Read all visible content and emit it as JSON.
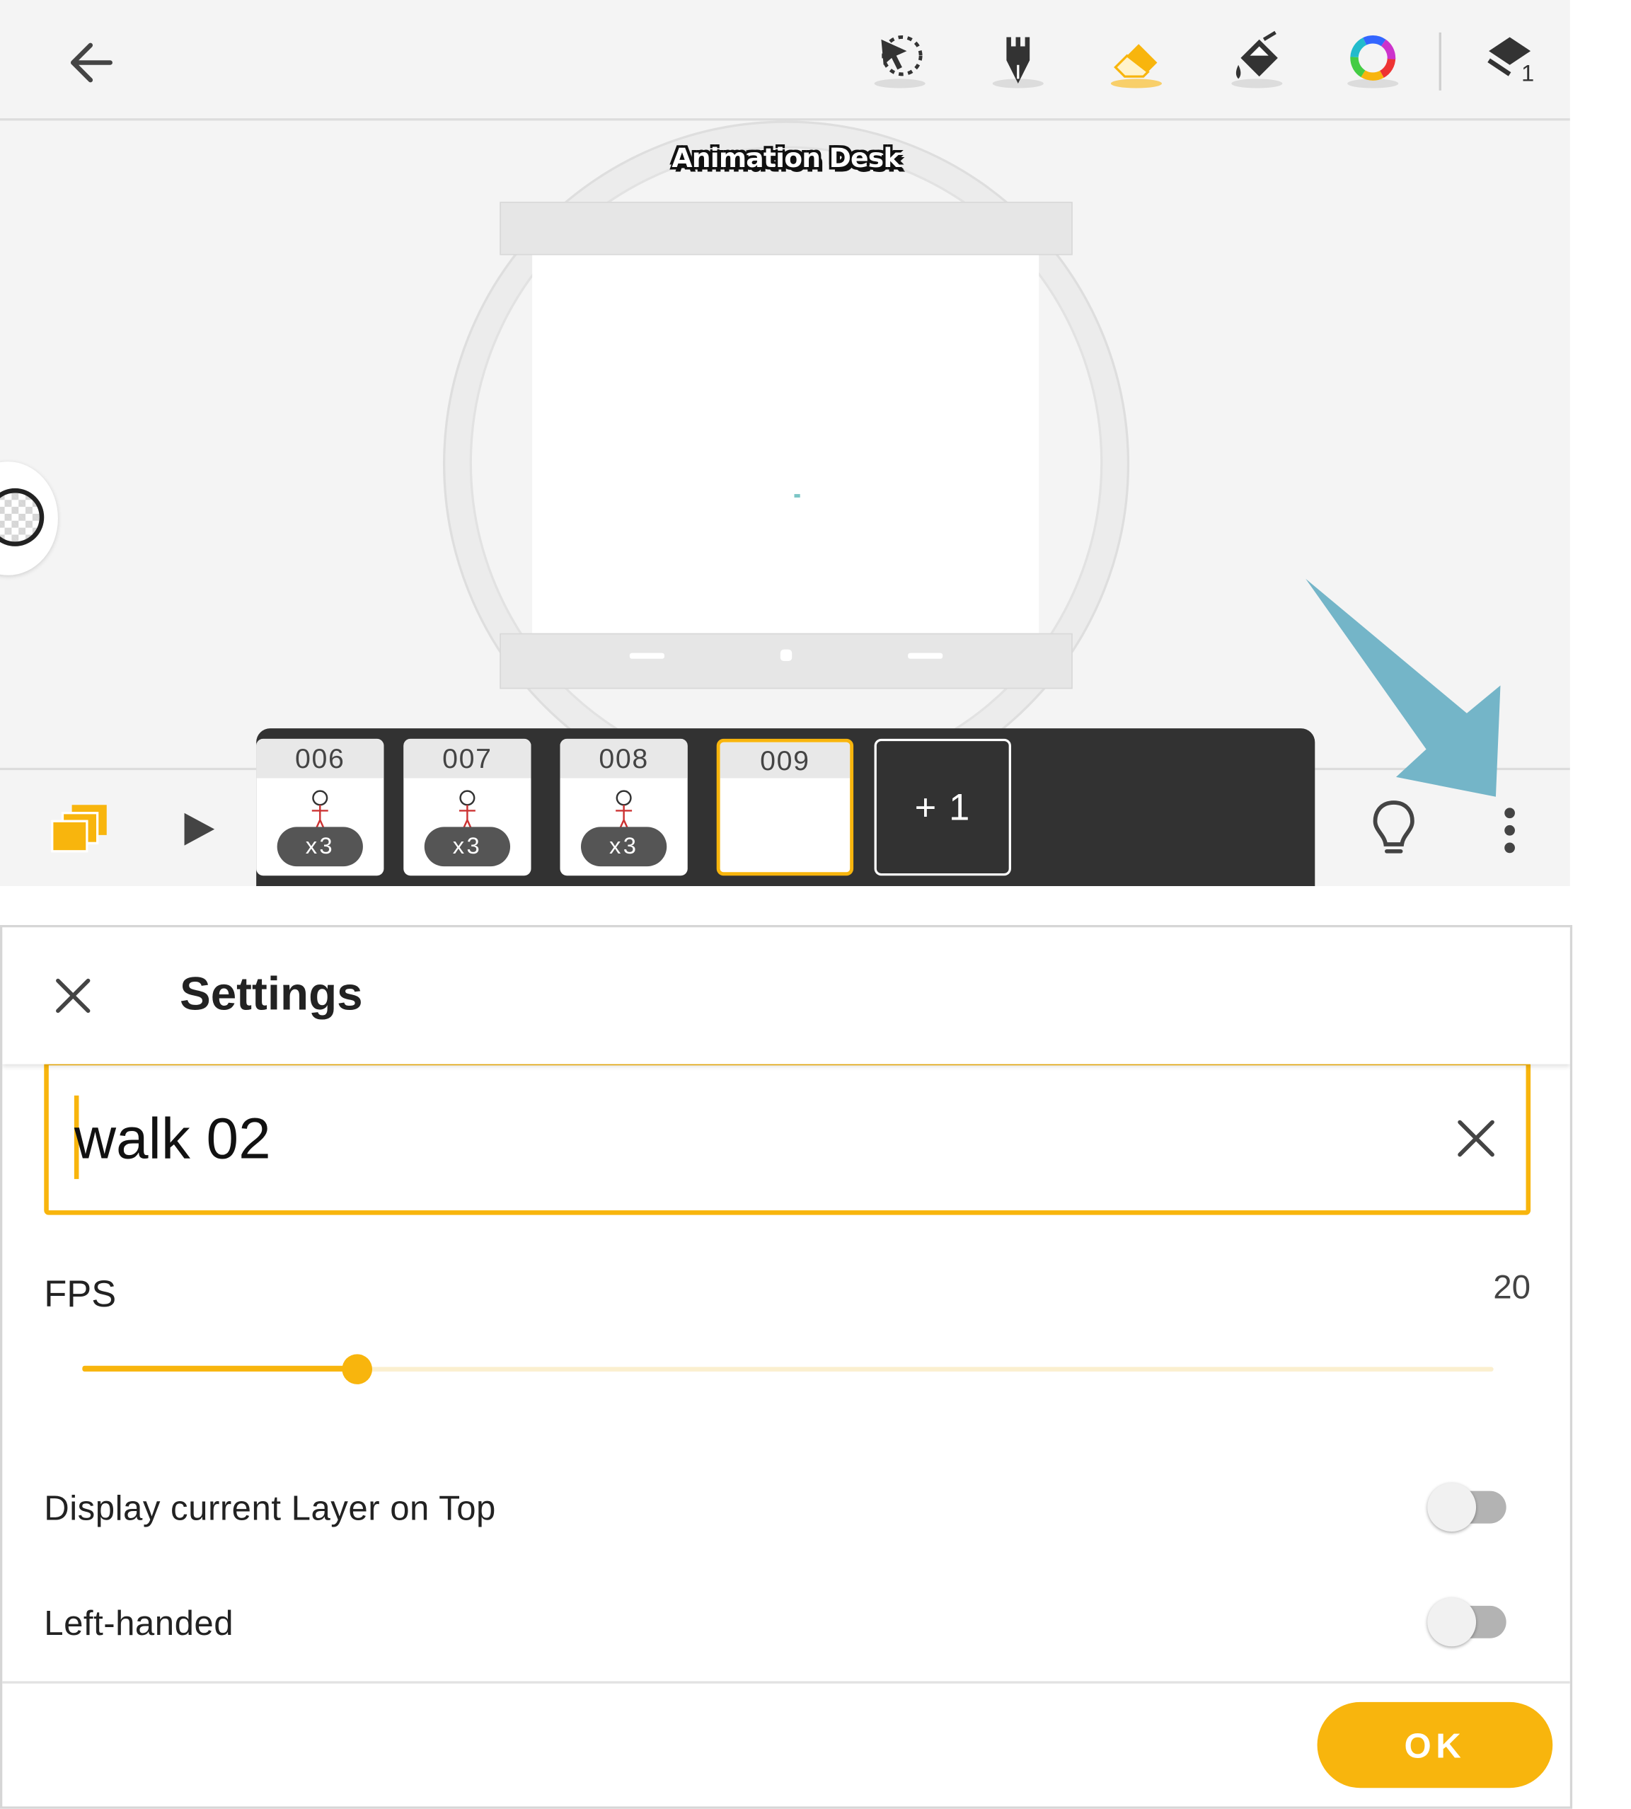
{
  "app": {
    "brand": "Animation Desk",
    "toolbar": {
      "tools": [
        "lasso-select-icon",
        "pencil-icon",
        "eraser-icon",
        "paint-bucket-icon",
        "color-wheel-icon"
      ],
      "active_tool": "eraser-icon",
      "layers_count": "1"
    },
    "timeline": {
      "frames": [
        {
          "number": "006",
          "repeat": "x3"
        },
        {
          "number": "007",
          "repeat": "x3"
        },
        {
          "number": "008",
          "repeat": "x3"
        },
        {
          "number": "009",
          "repeat": ""
        }
      ],
      "add_frame_label": "+ 1"
    }
  },
  "settings": {
    "title": "Settings",
    "name_value": "walk 02",
    "fps_label": "FPS",
    "fps_value": "20",
    "fps_slider_fraction": 0.195,
    "options": [
      {
        "label": "Display current Layer on Top",
        "on": false
      },
      {
        "label": "Left-handed",
        "on": false
      }
    ],
    "ok_label": "OK"
  },
  "colors": {
    "accent": "#f8b50d",
    "timeline_bg": "#323232",
    "pointer_arrow": "#74b5c8"
  }
}
